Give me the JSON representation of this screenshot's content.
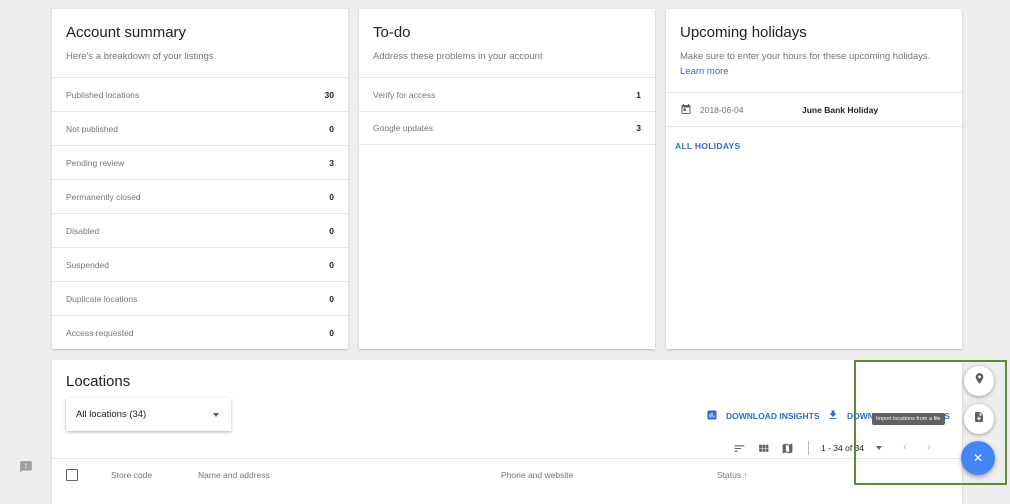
{
  "account_summary": {
    "title": "Account summary",
    "subtitle": "Here's a breakdown of your listings",
    "rows": [
      {
        "label": "Published locations",
        "value": "30"
      },
      {
        "label": "Not published",
        "value": "0"
      },
      {
        "label": "Pending review",
        "value": "3"
      },
      {
        "label": "Permanently closed",
        "value": "0"
      },
      {
        "label": "Disabled",
        "value": "0"
      },
      {
        "label": "Suspended",
        "value": "0"
      },
      {
        "label": "Duplicate locations",
        "value": "0"
      },
      {
        "label": "Access requested",
        "value": "0"
      }
    ]
  },
  "todo": {
    "title": "To-do",
    "subtitle": "Address these problems in your account",
    "rows": [
      {
        "label": "Verify for access",
        "value": "1"
      },
      {
        "label": "Google updates",
        "value": "3"
      }
    ]
  },
  "holidays": {
    "title": "Upcoming holidays",
    "subtitle": "Make sure to enter your hours for these upcoming holidays.",
    "learn_more": "Learn more",
    "items": [
      {
        "date": "2018-06-04",
        "name": "June Bank Holiday"
      }
    ],
    "all_link": "ALL HOLIDAYS"
  },
  "locations": {
    "title": "Locations",
    "filter_selected": "All locations (34)",
    "download_insights": "DOWNLOAD INSIGHTS",
    "download_locations": "DOWNLOAD LOCATIONS",
    "pager": "1 - 34 of 34",
    "columns": {
      "store_code": "Store code",
      "name_address": "Name and address",
      "phone_website": "Phone and website",
      "status": "Status ↑"
    }
  },
  "fab": {
    "tooltip": "Import locations from a file",
    "close_glyph": "✕"
  },
  "colors": {
    "accent": "#4285f4",
    "link": "#3367d6",
    "highlight": "#5b8a3b"
  }
}
